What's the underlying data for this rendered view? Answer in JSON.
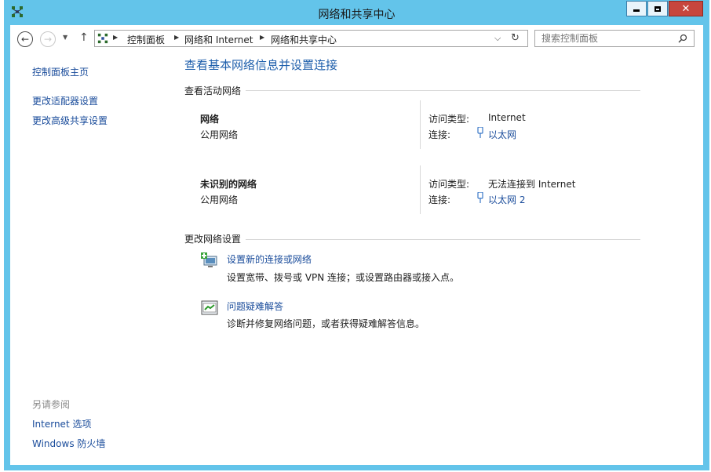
{
  "window": {
    "title": "网络和共享中心",
    "controls": {
      "minimize": "▁",
      "maximize": "□",
      "close": "✕"
    }
  },
  "navigation": {
    "breadcrumb": [
      "控制面板",
      "网络和 Internet",
      "网络和共享中心"
    ],
    "search_placeholder": "搜索控制面板"
  },
  "sidebar": {
    "home": "控制面板主页",
    "links": [
      "更改适配器设置",
      "更改高级共享设置"
    ],
    "see_also_heading": "另请参阅",
    "see_also": [
      "Internet 选项",
      "Windows 防火墙"
    ]
  },
  "main": {
    "title": "查看基本网络信息并设置连接",
    "active_networks_heading": "查看活动网络",
    "networks": [
      {
        "name": "网络",
        "type": "公用网络",
        "access_label": "访问类型:",
        "access_value": "Internet",
        "conn_label": "连接:",
        "conn_value": "以太网"
      },
      {
        "name": "未识别的网络",
        "type": "公用网络",
        "access_label": "访问类型:",
        "access_value": "无法连接到 Internet",
        "conn_label": "连接:",
        "conn_value": "以太网 2"
      }
    ],
    "change_heading": "更改网络设置",
    "tasks": [
      {
        "title": "设置新的连接或网络",
        "desc": "设置宽带、拨号或 VPN 连接；或设置路由器或接入点。"
      },
      {
        "title": "问题疑难解答",
        "desc": "诊断并修复网络问题，或者获得疑难解答信息。"
      }
    ]
  },
  "colors": {
    "accent": "#63c4ea",
    "link": "#1a4c9b",
    "title": "#1d5eab",
    "close": "#c7463d"
  }
}
